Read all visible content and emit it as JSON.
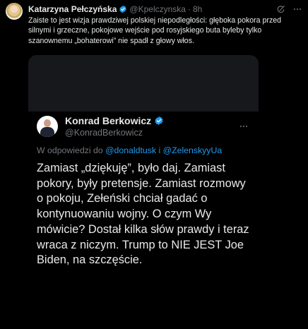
{
  "tweet": {
    "author_name": "Katarzyna Pełczyńska",
    "handle": "@Kpelczynska",
    "separator": "·",
    "time": "8h",
    "text": "Zaiste to jest wizja prawdziwej polskiej niepodległości: głęboka pokora przed silnymi i grzeczne, pokojowe wejście pod rosyjskiego buta byleby tylko szanownemu „bohaterowi” nie spadł z głowy włos.",
    "icons": [
      "grok-icon",
      "more-icon"
    ]
  },
  "quoted": {
    "author_name": "Konrad Berkowicz",
    "handle": "@KonradBerkowicz",
    "reply_prefix": "W odpowiedzi do ",
    "mention_1": "@donaldtusk",
    "reply_joiner": " i ",
    "mention_2": "@ZelenskyyUa",
    "text": "Zamiast „dziękuję”, było daj. Zamiast pokory, były pretensje. Zamiast rozmowy o pokoju, Zełeński chciał gadać o kontynuowaniu wojny. O czym Wy mówicie? Dostał kilka słów prawdy i teraz wraca z niczym. Trump to NIE JEST Joe Biden, na szczęście."
  },
  "colors": {
    "background": "#000000",
    "text": "#e7e9ea",
    "secondary": "#71767b",
    "accent": "#1d9bf0",
    "media_frame": "#16181b"
  }
}
